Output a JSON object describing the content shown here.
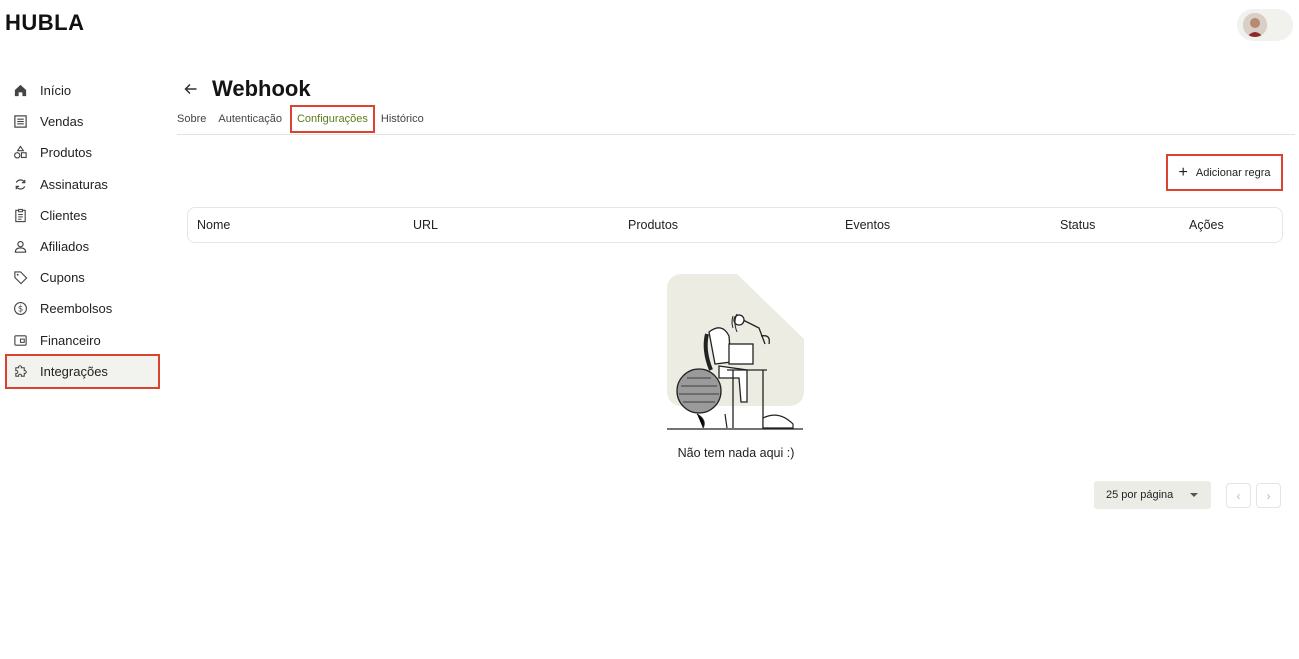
{
  "brand": {
    "logo_text": "HUBLA"
  },
  "user": {
    "avatar_alt": "avatar"
  },
  "sidebar": {
    "items": [
      {
        "label": "Início",
        "icon": "home-icon"
      },
      {
        "label": "Vendas",
        "icon": "list-icon"
      },
      {
        "label": "Produtos",
        "icon": "shapes-icon"
      },
      {
        "label": "Assinaturas",
        "icon": "refresh-icon"
      },
      {
        "label": "Clientes",
        "icon": "clipboard-icon"
      },
      {
        "label": "Afiliados",
        "icon": "user-icon"
      },
      {
        "label": "Cupons",
        "icon": "tag-icon"
      },
      {
        "label": "Reembolsos",
        "icon": "dollar-circle-icon"
      },
      {
        "label": "Financeiro",
        "icon": "wallet-icon"
      },
      {
        "label": "Integrações",
        "icon": "puzzle-icon",
        "active": true
      }
    ]
  },
  "page": {
    "title": "Webhook"
  },
  "tabs": [
    {
      "label": "Sobre"
    },
    {
      "label": "Autenticação"
    },
    {
      "label": "Configurações",
      "active": true
    },
    {
      "label": "Histórico"
    }
  ],
  "actions": {
    "add_rule_label": "Adicionar regra"
  },
  "table": {
    "columns": [
      "Nome",
      "URL",
      "Produtos",
      "Eventos",
      "Status",
      "Ações"
    ],
    "rows": []
  },
  "empty_state": {
    "message": "Não tem nada aqui :)"
  },
  "pagination": {
    "page_size_label": "25 por página",
    "prev": "‹",
    "next": "›"
  },
  "colors": {
    "accent": "#5a7d1c",
    "highlight": "#d9432f",
    "muted_bg": "#ebece6"
  }
}
